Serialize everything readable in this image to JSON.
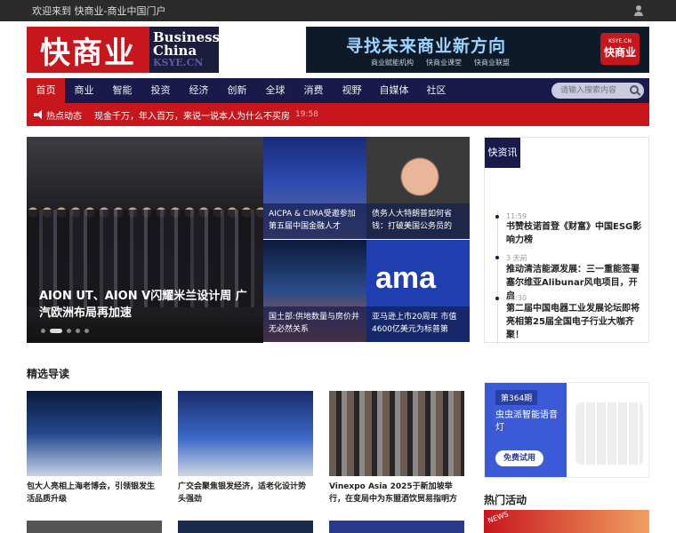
{
  "topbar": {
    "welcome": "欢迎来到 快商业-商业中国门户"
  },
  "logo": {
    "cn": "快商业",
    "en1": "Business",
    "en2": "China",
    "en3": "KSYE.CN"
  },
  "banner": {
    "title": "寻找未来商业新方向",
    "links": [
      "商业赋能机构",
      "快商业课堂",
      "快商业联盟"
    ],
    "badge_top": "KSYE.CN",
    "badge_main": "快商业"
  },
  "nav": {
    "items": [
      "首页",
      "商业",
      "智能",
      "投资",
      "经济",
      "创新",
      "全球",
      "消费",
      "视野",
      "自媒体",
      "社区"
    ],
    "search_placeholder": "请输入搜索内容"
  },
  "ticker": {
    "label": "热点动态",
    "headline": "现金千万，年入百万，来说一说本人为什么不买房",
    "time": "19:58"
  },
  "hero": {
    "caption": "AION UT、AION V闪耀米兰设计周 广汽欧洲布局再加速"
  },
  "tiles": [
    {
      "caption": "AICPA & CIMA受邀参加第五届中国金融人才"
    },
    {
      "caption": "债务人大特朗普如何省钱：打破美国公务员的"
    },
    {
      "caption": "国土部:供地数量与房价并无必然关系"
    },
    {
      "caption": "亚马逊上市20周年 市值4600亿美元为标普第"
    }
  ],
  "tile_logo": "ama",
  "news": {
    "tab": "快资讯",
    "items": [
      {
        "time": "11:59",
        "title": "书赞枝诺首登《财富》中国ESG影响力榜"
      },
      {
        "time": "3 天前",
        "title": "推动清洁能源发展：三一重能签署塞尔维亚Alibunar风电项目，开启"
      },
      {
        "time": "15:30",
        "title": "第二届中国电器工业发展论坛即将亮相第25届全国电子行业大咖齐聚！"
      }
    ]
  },
  "featured": {
    "title": "精选导读",
    "cards": [
      {
        "title": "包大人亮相上海老博会，引领银发生活品质升级"
      },
      {
        "title": "广交会聚焦银发经济，适老化设计势头强劲"
      },
      {
        "title": "Vinexpo Asia 2025于新加坡举行，在变局中为东盟酒饮贸易指明方"
      }
    ]
  },
  "ad": {
    "issue": "第364期",
    "title": "虫虫派智能语音灯",
    "button": "免费试用"
  },
  "hot": {
    "title": "热门活动",
    "badge": "NEWS"
  }
}
